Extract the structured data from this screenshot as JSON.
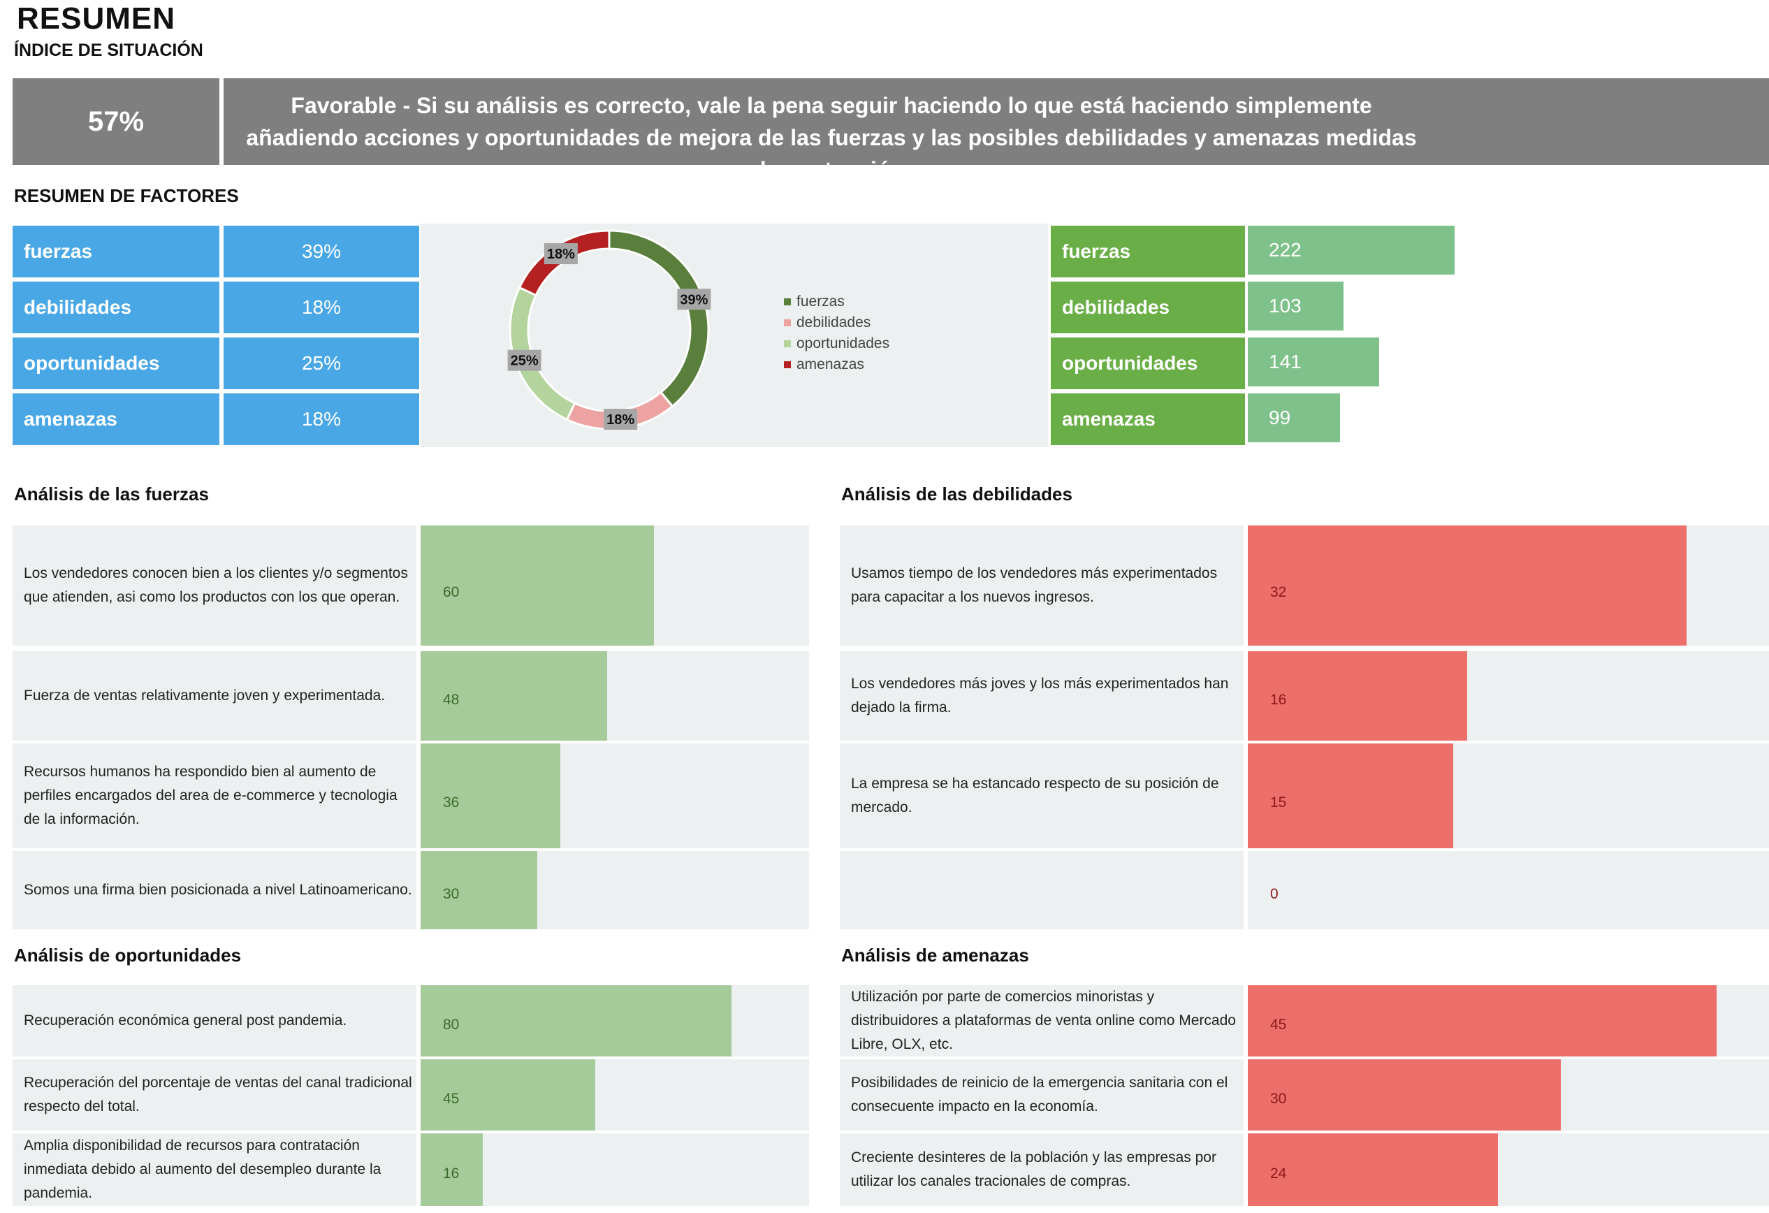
{
  "header": {
    "title": "RESUMEN",
    "subtitle": "ÍNDICE DE SITUACIÓN",
    "index_value": "57%",
    "index_text": "Favorable - Si su análisis es correcto, vale la pena seguir haciendo lo que está haciendo simplemente añadiendo acciones y oportunidades de mejora de las fuerzas y las posibles debilidades y amenazas medidas de contención."
  },
  "factors": {
    "title": "RESUMEN DE FACTORES",
    "rows": [
      {
        "label": "fuerzas",
        "percent": "39%",
        "count": "222",
        "count_value": 222
      },
      {
        "label": "debilidades",
        "percent": "18%",
        "count": "103",
        "count_value": 103
      },
      {
        "label": "oportunidades",
        "percent": "25%",
        "count": "141",
        "count_value": 141
      },
      {
        "label": "amenazas",
        "percent": "18%",
        "count": "99",
        "count_value": 99
      }
    ]
  },
  "chart_data": {
    "type": "pie",
    "donut": true,
    "categories": [
      "fuerzas",
      "debilidades",
      "oportunidades",
      "amenazas"
    ],
    "values": [
      39,
      18,
      25,
      18
    ],
    "data_labels": [
      "39%",
      "18%",
      "25%",
      "18%"
    ],
    "colors": [
      "#5a7f3c",
      "#eea3a3",
      "#b4d49e",
      "#b52020"
    ],
    "legend": "right"
  },
  "sections": {
    "fuerzas": {
      "title": "Análisis de las fuerzas",
      "max": 100,
      "items": [
        {
          "text": "Los vendedores conocen bien a los clientes y/o segmentos que atienden, asi como los productos con los que operan.",
          "value": 60,
          "label": "60"
        },
        {
          "text": "Fuerza de ventas relativamente joven y experimentada.",
          "value": 48,
          "label": "48"
        },
        {
          "text": "Recursos humanos ha respondido bien al aumento de perfiles encargados del area de e-commerce y tecnologia de la información.",
          "value": 36,
          "label": "36"
        },
        {
          "text": "Somos una firma bien posicionada a nivel Latinoamericano.",
          "value": 30,
          "label": "30"
        }
      ]
    },
    "debilidades": {
      "title": "Análisis de las debilidades",
      "max": 38,
      "items": [
        {
          "text": "Usamos tiempo de los vendedores más experimentados para capacitar a los nuevos ingresos.",
          "value": 32,
          "label": "32"
        },
        {
          "text": "Los vendedores más joves y los más experimentados han dejado la firma.",
          "value": 16,
          "label": "16"
        },
        {
          "text": "La empresa se ha estancado respecto de su posición de mercado.",
          "value": 15,
          "label": "15"
        },
        {
          "text": "",
          "value": 0,
          "label": "0"
        }
      ]
    },
    "oportunidades": {
      "title": "Análisis de oportunidades",
      "max": 100,
      "items": [
        {
          "text": "Recuperación económica general post pandemia.",
          "value": 80,
          "label": "80"
        },
        {
          "text": "Recuperación del porcentaje de ventas del canal tradicional respecto del total.",
          "value": 45,
          "label": "45"
        },
        {
          "text": "Amplia disponibilidad de recursos para contratación inmediata debido al aumento del desempleo durante la pandemia.",
          "value": 16,
          "label": "16"
        }
      ]
    },
    "amenazas": {
      "title": "Análisis de amenazas",
      "max": 50,
      "items": [
        {
          "text": "Utilización por parte de comercios minoristas y distribuidores a plataformas de venta online como Mercado Libre, OLX, etc.",
          "value": 45,
          "label": "45"
        },
        {
          "text": "Posibilidades de reinicio de la emergencia sanitaria con el consecuente impacto en la economía.",
          "value": 30,
          "label": "30"
        },
        {
          "text": "Creciente desinteres de la población y las empresas por utilizar los canales tracionales de compras.",
          "value": 24,
          "label": "24"
        }
      ]
    }
  }
}
